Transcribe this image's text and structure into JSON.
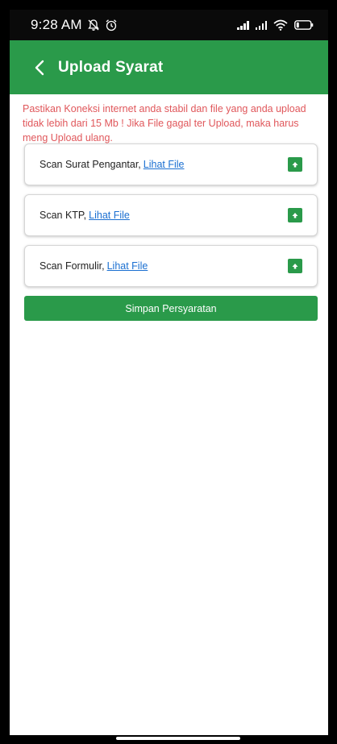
{
  "status_bar": {
    "time": "9:28 AM",
    "icons": [
      "notifications-off-icon",
      "alarm-icon",
      "signal-icon",
      "signal-icon",
      "wifi-icon",
      "battery-icon"
    ]
  },
  "app_bar": {
    "title": "Upload Syarat",
    "back_icon": "chevron-left-icon",
    "background": "#2a9a4a"
  },
  "warning": {
    "text": "Pastikan Koneksi internet anda stabil dan file yang anda upload tidak lebih dari 15 Mb ! Jika File gagal ter Upload, maka harus meng Upload ulang.",
    "color": "#e0575b"
  },
  "documents": [
    {
      "label": "Scan Surat Pengantar,",
      "link": "Lihat File",
      "action_icon": "upload-icon"
    },
    {
      "label": "Scan KTP,",
      "link": "Lihat File",
      "action_icon": "upload-icon"
    },
    {
      "label": "Scan Formulir,",
      "link": "Lihat File",
      "action_icon": "upload-icon"
    }
  ],
  "save_button": {
    "label": "Simpan Persyaratan"
  },
  "colors": {
    "accent": "#2a9a4a",
    "link": "#1a6fd1"
  }
}
